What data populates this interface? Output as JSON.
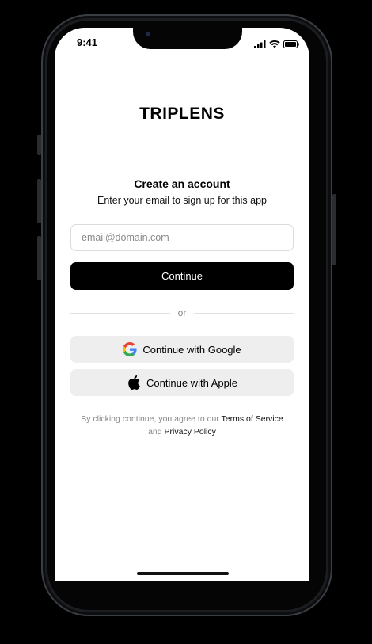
{
  "status_bar": {
    "time": "9:41",
    "icons": [
      "signal-icon",
      "wifi-icon",
      "battery-icon"
    ]
  },
  "app": {
    "title": "TRIPLENS"
  },
  "signup": {
    "heading": "Create an account",
    "subheading": "Enter your email to sign up for this app",
    "email_placeholder": "email@domain.com",
    "email_value": "",
    "continue_label": "Continue",
    "divider_label": "or",
    "google_label": "Continue with Google",
    "apple_label": "Continue with Apple"
  },
  "terms": {
    "prefix": "By clicking continue, you agree to our",
    "terms_link": "Terms of Service",
    "conjunction": "and",
    "privacy_link": "Privacy Policy"
  },
  "colors": {
    "primary_button": "#000000",
    "social_button": "#eeeeee",
    "muted_text": "#888888",
    "screen_background": "#ffffff"
  }
}
